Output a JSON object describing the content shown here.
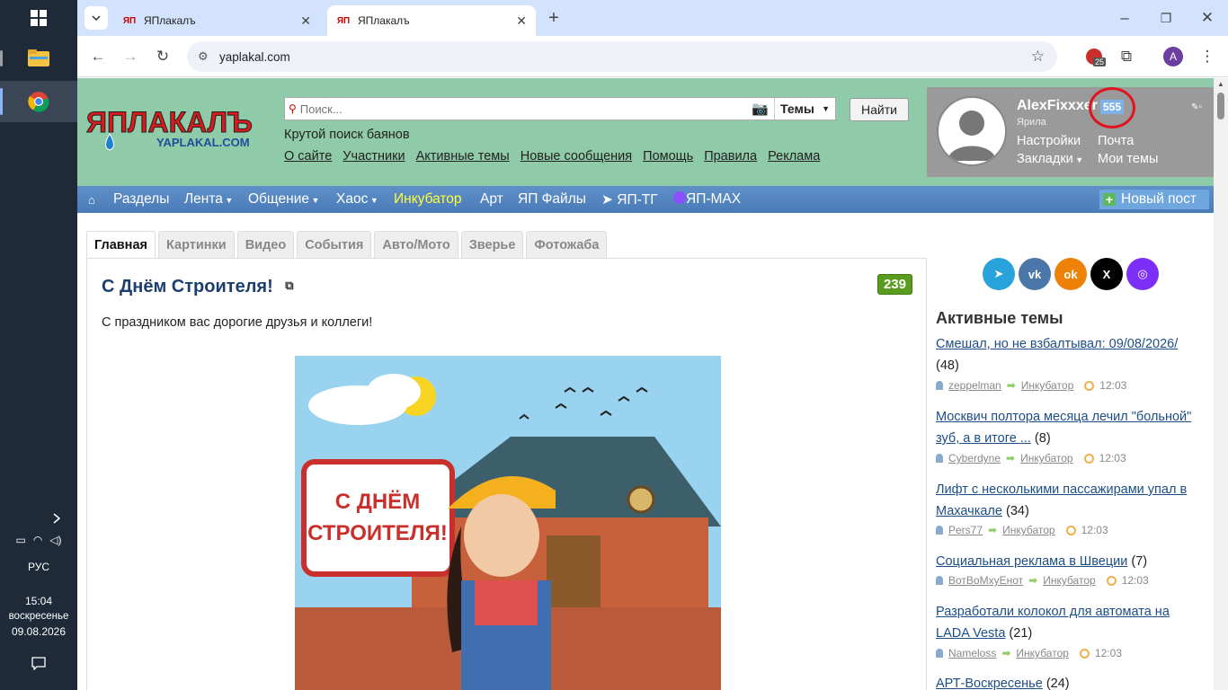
{
  "taskbar": {
    "lang": "РУС",
    "time": "15:04",
    "day": "воскресенье",
    "date": "09.08.2026"
  },
  "browser": {
    "tabs": [
      {
        "title": "ЯПлакалъ"
      },
      {
        "title": "ЯПлакалъ"
      }
    ],
    "url": "yaplakal.com",
    "extension_badge": "25",
    "profile_letter": "A"
  },
  "header": {
    "logo_text": "ЯПЛАКАЛЪ",
    "logo_sub": "YAPLAKAL.COM",
    "search_placeholder": "Поиск...",
    "search_scope": "Темы",
    "find_button": "Найти",
    "tagline": "Крутой поиск баянов",
    "nav": [
      "О сайте",
      "Участники",
      "Активные темы",
      "Новые сообщения",
      "Помощь",
      "Правила",
      "Реклама"
    ]
  },
  "user": {
    "name": "AlexFixxxer",
    "karma": "555",
    "rank": "Ярила",
    "settings": "Настройки",
    "bookmarks": "Закладки",
    "mail": "Почта",
    "my_topics": "Мои темы"
  },
  "menu": {
    "items": [
      "Разделы",
      "Лента",
      "Общение",
      "Хаос",
      "Инкубатор",
      "Арт",
      "ЯП Файлы",
      "ЯП-ТГ",
      "ЯП-MAX"
    ],
    "new_post": "Новый пост"
  },
  "content_tabs": [
    "Главная",
    "Картинки",
    "Видео",
    "События",
    "Авто/Мото",
    "Зверье",
    "Фотожаба"
  ],
  "post": {
    "title": "С Днём Строителя!",
    "count": "239",
    "text": "С праздником вас дорогие друзья и коллеги!",
    "image_sign_line1": "С ДНЁМ",
    "image_sign_line2": "СТРОИТЕЛЯ!"
  },
  "sidebar": {
    "title": "Активные темы",
    "topics": [
      {
        "title": "Смешал, но не взбалтывал: 09/08/2026/",
        "count": "(48)",
        "user": "zeppelman",
        "section": "Инкубатор",
        "time": "12:03"
      },
      {
        "title": "Москвич полтора месяца лечил \"больной\" зуб, а в итоге ...",
        "count": "(8)",
        "user": "Cyberdyne",
        "section": "Инкубатор",
        "time": "12:03"
      },
      {
        "title": "Лифт с несколькими пассажирами упал в Махачкале",
        "count": "(34)",
        "user": "Pers77",
        "section": "Инкубатор",
        "time": "12:03"
      },
      {
        "title": "Социальная реклама в Швеции",
        "count": "(7)",
        "user": "ВотВоМхуЕнот",
        "section": "Инкубатор",
        "time": "12:03"
      },
      {
        "title": "Разработали колокол для автомата на LADA Vesta",
        "count": "(21)",
        "user": "Nameloss",
        "section": "Инкубатор",
        "time": "12:03"
      },
      {
        "title": "АРТ-Воскресенье",
        "count": "(24)"
      }
    ]
  },
  "colors": {
    "header_bg": "#8fcaa9",
    "menu_bg": "#4a7bb7",
    "userbox_bg": "#9a9a9a",
    "count_badge": "#5a9b20",
    "link": "#1c4e86"
  }
}
